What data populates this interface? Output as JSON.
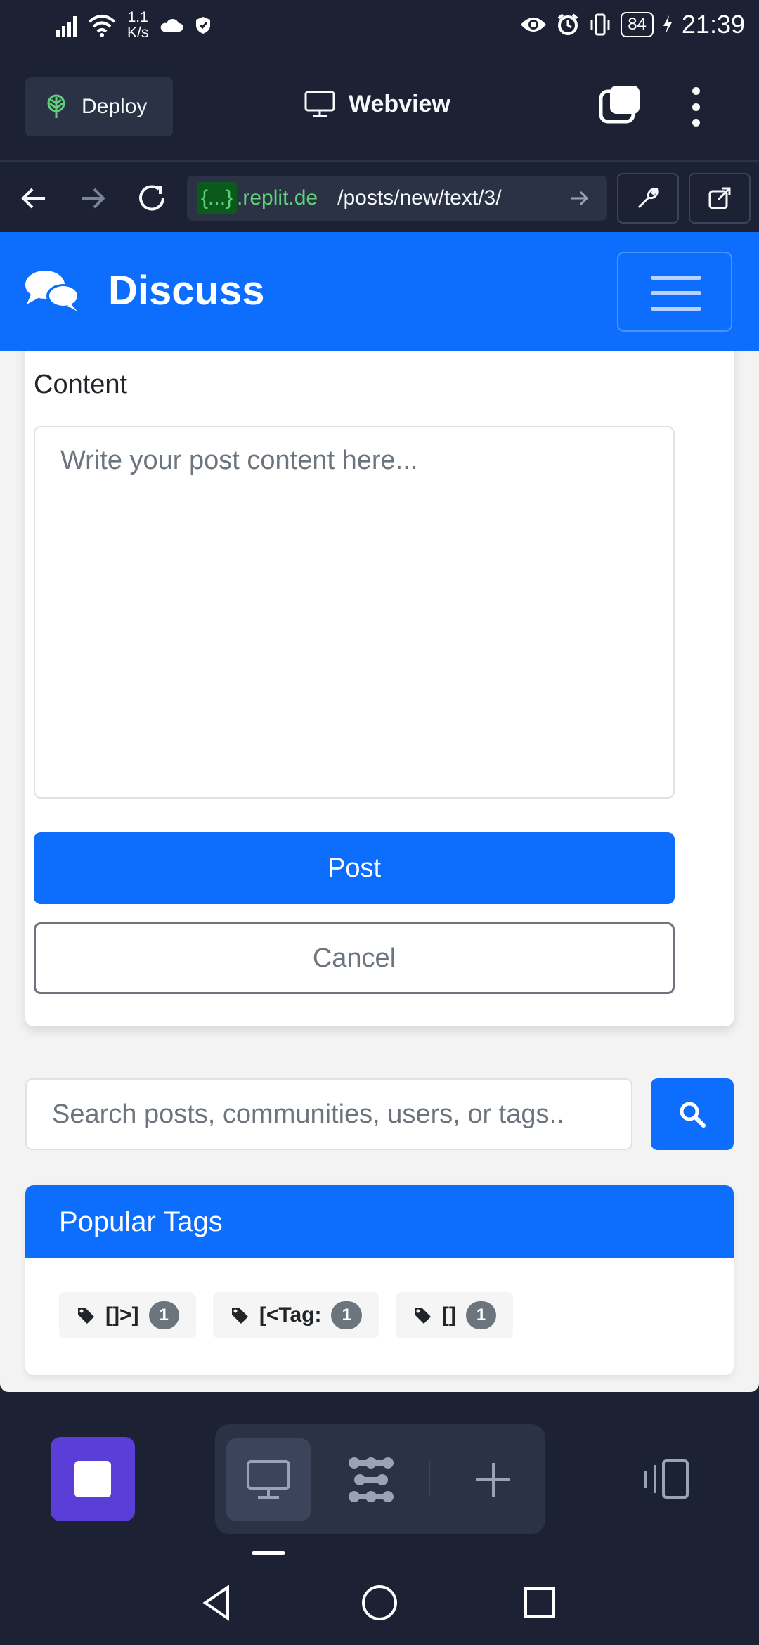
{
  "status_bar": {
    "network_speed": "1.1\nK/s",
    "network_speed_value": "1.1",
    "network_speed_unit": "K/s",
    "battery": "84",
    "time": "21:39"
  },
  "replit": {
    "deploy_label": "Deploy",
    "view_label": "Webview",
    "url_domain_highlight": "{...}",
    "url_domain": ".replit.de",
    "url_path": "/posts/new/text/3/"
  },
  "site": {
    "brand": "Discuss",
    "accent_color": "#0d6efd"
  },
  "form": {
    "content_label": "Content",
    "content_placeholder": "Write your post content here...",
    "content_value": "",
    "post_button": "Post",
    "cancel_button": "Cancel"
  },
  "search": {
    "placeholder": "Search posts, communities, users, or tags.."
  },
  "popular_tags": {
    "title": "Popular Tags",
    "tags": [
      {
        "name": "[]>]",
        "count": "1"
      },
      {
        "name": "[<Tag:",
        "count": "1"
      },
      {
        "name": "[]",
        "count": "1"
      }
    ]
  },
  "icons": {
    "deploy": "deploy-icon",
    "webview": "monitor-icon",
    "back": "arrow-left-icon",
    "forward": "arrow-right-icon",
    "reload": "reload-icon",
    "devtools": "wrench-icon",
    "open_external": "external-link-icon",
    "brand": "chat-bubbles-icon",
    "search": "search-icon",
    "tag": "tag-icon"
  }
}
